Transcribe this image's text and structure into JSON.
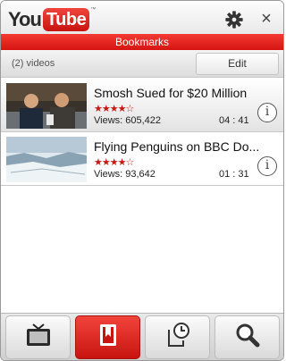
{
  "app": {
    "logo_you": "You",
    "logo_tube": "Tube",
    "logo_tm": "™"
  },
  "header": {
    "title": "Bookmarks",
    "close_glyph": "×"
  },
  "list_header": {
    "count": "(2) videos",
    "edit_label": "Edit"
  },
  "videos": [
    {
      "title": "Smosh Sued for $20 Million",
      "rating_stars": "★★★★☆",
      "views": "Views: 605,422",
      "duration": "04 : 41",
      "info_glyph": "i",
      "selected": true
    },
    {
      "title": "Flying Penguins on BBC Do...",
      "rating_stars": "★★★★☆",
      "views": "Views: 93,642",
      "duration": "01 : 31",
      "info_glyph": "i",
      "selected": false
    }
  ],
  "tabs": [
    {
      "icon": "tv-icon",
      "active": false
    },
    {
      "icon": "bookmark-icon",
      "active": true
    },
    {
      "icon": "history-icon",
      "active": false
    },
    {
      "icon": "search-icon",
      "active": false
    }
  ],
  "colors": {
    "accent_red": "#d61511",
    "star_red": "#c61812"
  }
}
